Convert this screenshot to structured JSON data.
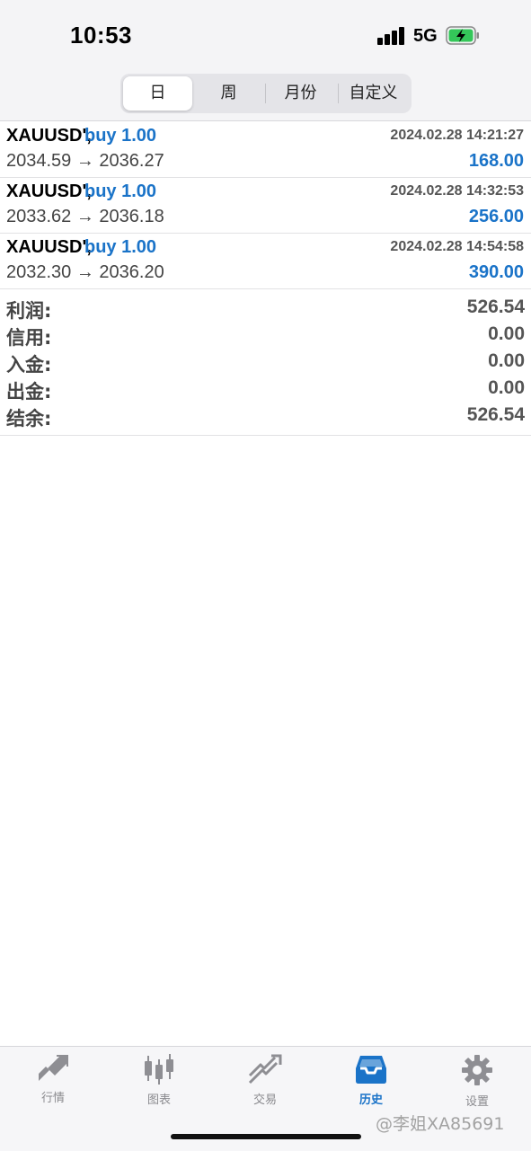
{
  "status_bar": {
    "time": "10:53",
    "network": "5G"
  },
  "period_tabs": [
    {
      "label": "日",
      "active": true
    },
    {
      "label": "周",
      "active": false
    },
    {
      "label": "月份",
      "active": false
    },
    {
      "label": "自定义",
      "active": false
    }
  ],
  "trades": [
    {
      "symbol": "XAUUSD',",
      "side": "buy 1.00",
      "time": "2024.02.28 14:21:27",
      "prices": "2034.59 → 2036.27",
      "profit": "168.00"
    },
    {
      "symbol": "XAUUSD',",
      "side": "buy 1.00",
      "time": "2024.02.28 14:32:53",
      "prices": "2033.62 → 2036.18",
      "profit": "256.00"
    },
    {
      "symbol": "XAUUSD',",
      "side": "buy 1.00",
      "time": "2024.02.28 14:54:58",
      "prices": "2032.30 → 2036.20",
      "profit": "390.00"
    }
  ],
  "summary": [
    {
      "label": "利润:",
      "value": "526.54"
    },
    {
      "label": "信用:",
      "value": "0.00"
    },
    {
      "label": "入金:",
      "value": "0.00"
    },
    {
      "label": "出金:",
      "value": "0.00"
    },
    {
      "label": "结余:",
      "value": "526.54"
    }
  ],
  "bottom_tabs": [
    {
      "label": "行情",
      "icon": "quotes-arrow-icon",
      "active": false
    },
    {
      "label": "图表",
      "icon": "candlestick-chart-icon",
      "active": false
    },
    {
      "label": "交易",
      "icon": "trade-trend-icon",
      "active": false
    },
    {
      "label": "历史",
      "icon": "history-inbox-icon",
      "active": true
    },
    {
      "label": "设置",
      "icon": "gear-icon",
      "active": false
    }
  ],
  "watermark": "@李姐XA85691",
  "colors": {
    "accent": "#1a73c8",
    "battery": "#34c759"
  }
}
